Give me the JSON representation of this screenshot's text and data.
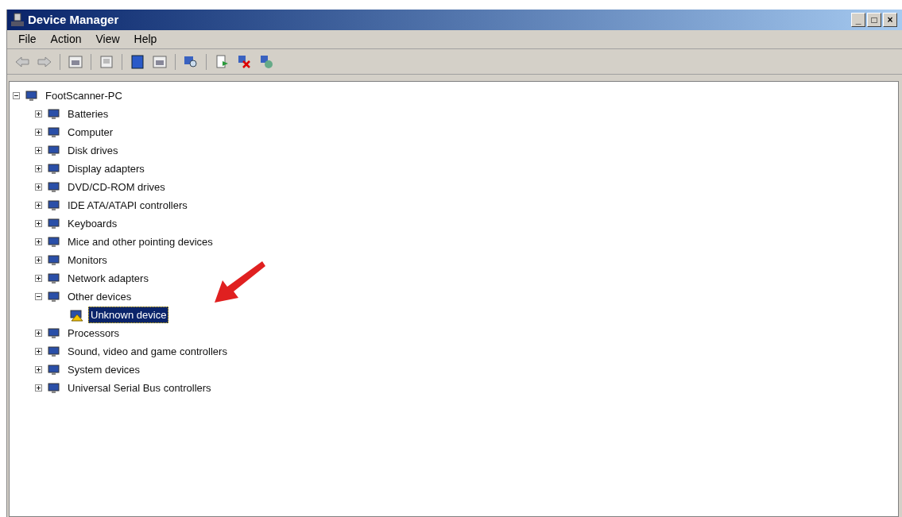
{
  "window": {
    "title": "Device Manager",
    "controls": [
      "_",
      "□",
      "×"
    ]
  },
  "menu": [
    {
      "label": "File"
    },
    {
      "label": "Action"
    },
    {
      "label": "View"
    },
    {
      "label": "Help"
    }
  ],
  "tree": {
    "label": "FootScanner-PC",
    "expanded": true,
    "selected": false,
    "children": [
      {
        "label": "Batteries",
        "expanded": false,
        "selected": false
      },
      {
        "label": "Computer",
        "expanded": false,
        "selected": false
      },
      {
        "label": "Disk drives",
        "expanded": false,
        "selected": false
      },
      {
        "label": "Display adapters",
        "expanded": false,
        "selected": false
      },
      {
        "label": "DVD/CD-ROM drives",
        "expanded": false,
        "selected": false
      },
      {
        "label": "IDE ATA/ATAPI controllers",
        "expanded": false,
        "selected": false
      },
      {
        "label": "Keyboards",
        "expanded": false,
        "selected": false
      },
      {
        "label": "Mice and other pointing devices",
        "expanded": false,
        "selected": false
      },
      {
        "label": "Monitors",
        "expanded": false,
        "selected": false
      },
      {
        "label": "Network adapters",
        "expanded": false,
        "selected": false
      },
      {
        "label": "Other devices",
        "expanded": true,
        "selected": false,
        "children": [
          {
            "label": "Unknown device",
            "selected": true
          }
        ]
      },
      {
        "label": "Processors",
        "expanded": false,
        "selected": false
      },
      {
        "label": "Sound, video and game controllers",
        "expanded": false,
        "selected": false
      },
      {
        "label": "System devices",
        "expanded": false,
        "selected": false
      },
      {
        "label": "Universal Serial Bus controllers",
        "expanded": false,
        "selected": false
      }
    ]
  }
}
